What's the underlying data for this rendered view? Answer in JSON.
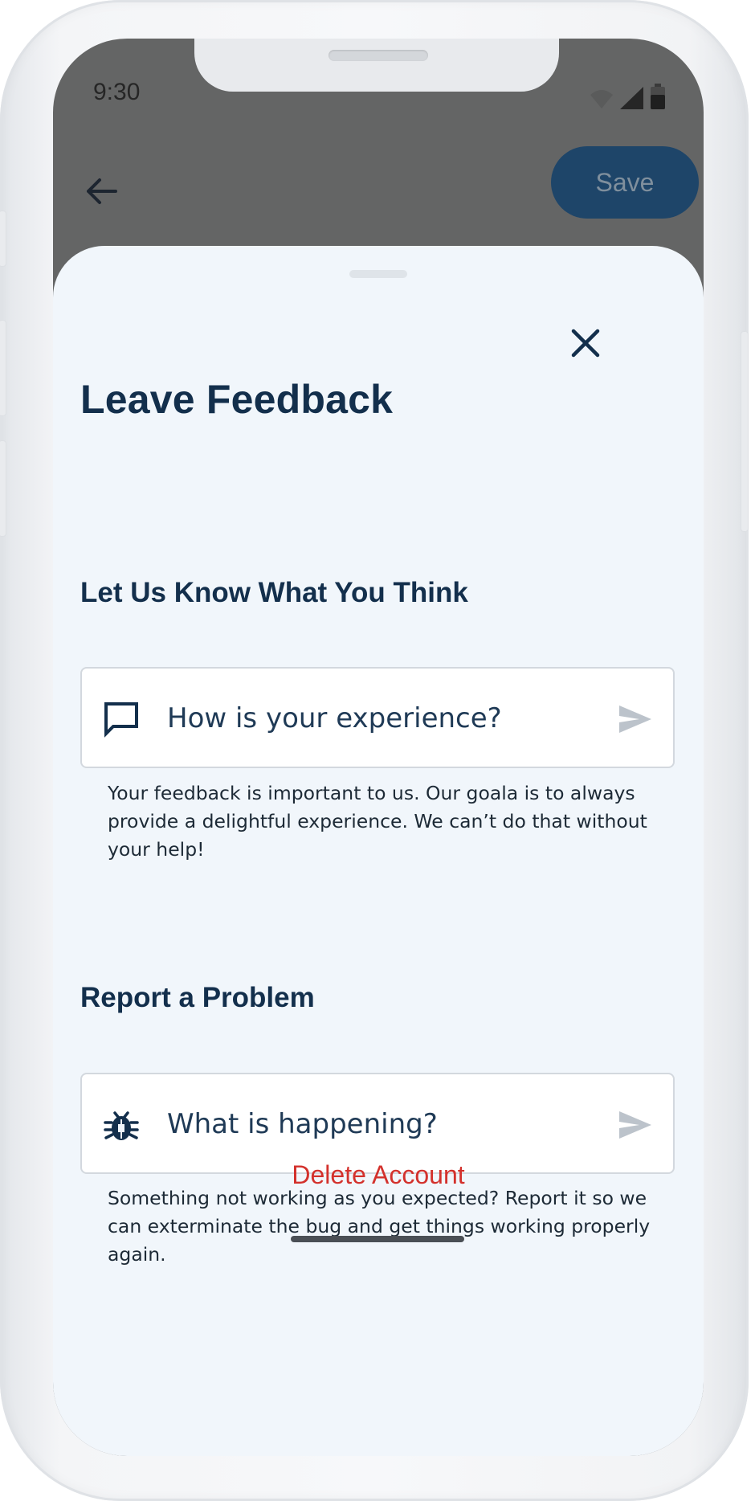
{
  "status_bar": {
    "time": "9:30",
    "icons": [
      "wifi-icon",
      "cellular-signal-icon",
      "battery-icon"
    ]
  },
  "app_bar": {
    "back_icon": "arrow-left-icon",
    "save_label": "Save"
  },
  "sheet": {
    "close_icon": "close-icon",
    "title": "Leave Feedback",
    "feedback": {
      "heading": "Let Us Know What You Think",
      "icon": "chat-bubble-icon",
      "placeholder": "How is your experience?",
      "value": "",
      "send_icon": "send-icon",
      "helper_text": "Your feedback is important to us. Our goala is to always provide a delightful experience. We can’t do that without your help!"
    },
    "problem": {
      "heading": "Report a Problem",
      "icon": "bug-icon",
      "placeholder": "What is happening?",
      "value": "",
      "send_icon": "send-icon",
      "helper_text": "Something not working as you expected? Report it so we can exterminate the bug and get things working properly again."
    },
    "delete_label": "Delete Account"
  },
  "colors": {
    "primary": "#132f4c",
    "save_button": "#1e4569",
    "sheet_background": "#f1f6fb",
    "danger": "#d3312c",
    "scrim": "#646565"
  }
}
